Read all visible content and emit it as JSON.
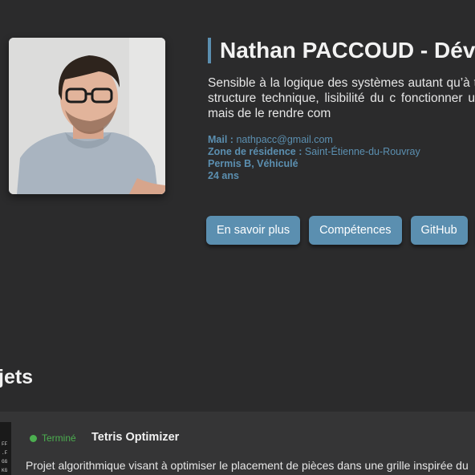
{
  "profile": {
    "name_title": "Nathan PACCOUD - Dév",
    "bio": "Sensible à la logique des systèmes autant qu’à trouver entre structure technique, lisibilité du c fonctionner un ensemble, mais de le rendre com",
    "mail_label": "Mail :",
    "mail_value": "nathpacc@gmail.com",
    "zone_label": "Zone de résidence :",
    "zone_value": "Saint-Étienne-du-Rouvray",
    "license": "Permis B, Véhiculé",
    "age": "24 ans"
  },
  "buttons": [
    {
      "label": "En savoir plus"
    },
    {
      "label": "Compétences"
    },
    {
      "label": "GitHub"
    },
    {
      "label": ""
    }
  ],
  "projects": {
    "heading": "jets",
    "items": [
      {
        "status": "Terminé",
        "title": "Tetris Optimizer",
        "description": "Projet algorithmique visant à optimiser le placement de pièces dans une grille inspirée du",
        "thumb_text": "FF\n.F\nGG\nKG"
      }
    ]
  },
  "colors": {
    "background": "#2b2b2c",
    "accent": "#5b8fb0",
    "status_done": "#4caf50",
    "card": "#353536"
  }
}
